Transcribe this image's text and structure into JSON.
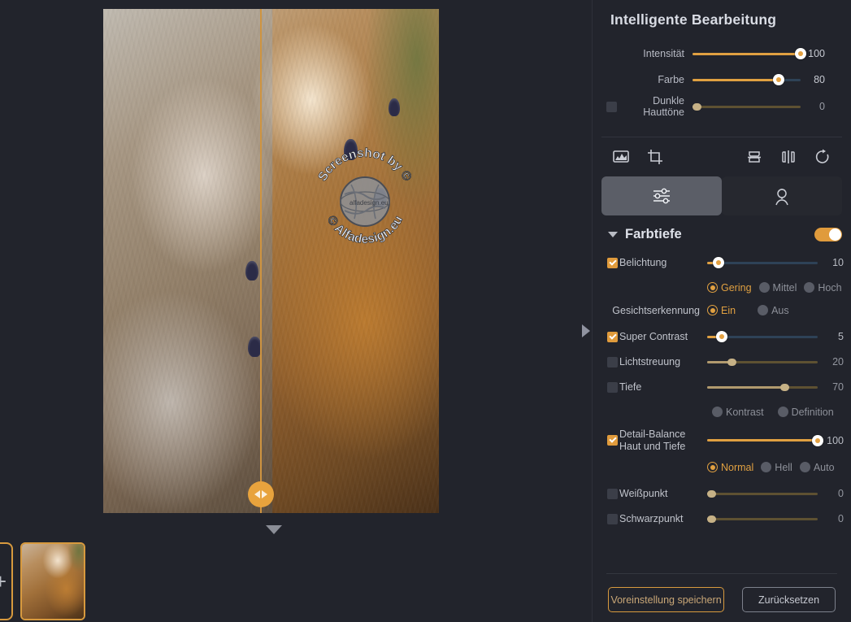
{
  "smart_edit": {
    "title": "Intelligente Bearbeitung",
    "rows": [
      {
        "label": "Intensität",
        "value": "100",
        "checkbox": null,
        "fill_pct": 100,
        "state": "active"
      },
      {
        "label": "Farbe",
        "value": "80",
        "checkbox": null,
        "fill_pct": 80,
        "state": "active"
      },
      {
        "label": "Dunkle Hauttöne",
        "label_line1": "Dunkle",
        "label_line2": "Hauttöne",
        "value": "0",
        "checkbox": "off",
        "fill_pct": 4,
        "state": "disabled"
      }
    ]
  },
  "toolbar": {
    "icons": [
      {
        "name": "histogram-icon"
      },
      {
        "name": "crop-icon"
      },
      {
        "name": "flip-vertical-icon"
      },
      {
        "name": "flip-horizontal-icon"
      },
      {
        "name": "rotate-icon"
      }
    ]
  },
  "tabs": [
    {
      "name": "tab-adjustments",
      "icon": "sliders-icon",
      "active": true
    },
    {
      "name": "tab-portrait",
      "icon": "portrait-icon",
      "active": false
    }
  ],
  "section": {
    "title": "Farbtiefe",
    "caret": "chevron-down-icon",
    "toggle_on": true
  },
  "adjustments": [
    {
      "label": "Belichtung",
      "value": "10",
      "checkbox": "on",
      "fill_pct": 10,
      "state": "active"
    },
    {
      "label": "Super Contrast",
      "value": "5",
      "checkbox": "on",
      "fill_pct": 13,
      "state": "active"
    },
    {
      "label": "Lichtstreuung",
      "value": "20",
      "checkbox": "off",
      "fill_pct": 22,
      "state": "disabled"
    },
    {
      "label": "Tiefe",
      "value": "70",
      "checkbox": "off",
      "fill_pct": 70,
      "state": "disabled"
    },
    {
      "label_line1": "Detail-Balance",
      "label_line2": "Haut und Tiefe",
      "value": "100",
      "checkbox": "on",
      "fill_pct": 100,
      "state": "active"
    },
    {
      "label": "Weißpunkt",
      "value": "0",
      "checkbox": "off",
      "fill_pct": 4,
      "state": "disabled"
    },
    {
      "label": "Schwarzpunkt",
      "value": "0",
      "checkbox": "off",
      "fill_pct": 4,
      "state": "disabled"
    }
  ],
  "radio_groups": {
    "belichtung_level": {
      "options": [
        {
          "label": "Gering",
          "selected": true
        },
        {
          "label": "Mittel",
          "selected": false
        },
        {
          "label": "Hoch",
          "selected": false
        }
      ]
    },
    "face_detection": {
      "label": "Gesichtserkennung",
      "options": [
        {
          "label": "Ein",
          "selected": true
        },
        {
          "label": "Aus",
          "selected": false
        }
      ]
    },
    "tiefe_mode": {
      "options": [
        {
          "label": "Kontrast",
          "selected": false
        },
        {
          "label": "Definition",
          "selected": false
        }
      ]
    },
    "detail_mode": {
      "options": [
        {
          "label": "Normal",
          "selected": true
        },
        {
          "label": "Hell",
          "selected": false
        },
        {
          "label": "Auto",
          "selected": false
        }
      ]
    }
  },
  "footer": {
    "save_preset_label": "Voreinstellung speichern",
    "reset_label": "Zurücksetzen"
  },
  "canvas": {
    "compare_handle": "compare-slider-handle",
    "expand_arrow": "expand-down-arrow",
    "panel_arrow": "panel-expand-arrow",
    "watermark": {
      "top_text": "Screenshot by",
      "bottom_text": "Alfadesign.eu",
      "logo_text": "alfadesign.eu"
    }
  },
  "filmstrip": {
    "add_label": "+",
    "thumbnails": [
      {
        "name": "thumbnail-1",
        "selected": true
      }
    ]
  },
  "colors": {
    "accent": "#e0a041",
    "panel_bg": "#22242c",
    "active_tab": "#5b5e67",
    "track_inactive": "#2e4257",
    "track_muted": "#5e5132"
  }
}
